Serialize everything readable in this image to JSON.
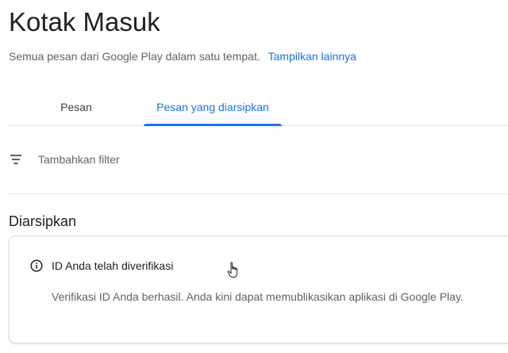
{
  "header": {
    "title": "Kotak Masuk",
    "subtitle": "Semua pesan dari Google Play dalam satu tempat.",
    "more_link": "Tampilkan lainnya"
  },
  "tabs": [
    {
      "label": "Pesan",
      "active": false
    },
    {
      "label": "Pesan yang diarsipkan",
      "active": true
    }
  ],
  "filter": {
    "icon": "filter-icon",
    "label": "Tambahkan filter"
  },
  "archived": {
    "heading": "Diarsipkan",
    "cards": [
      {
        "icon": "info-icon",
        "title": "ID Anda telah diverifikasi",
        "body": "Verifikasi ID Anda berhasil. Anda kini dapat memublikasikan aplikasi di Google Play."
      }
    ]
  },
  "colors": {
    "accent": "#1a73e8",
    "text_primary": "#202124",
    "text_secondary": "#5f6368",
    "divider": "#e3e3e3"
  }
}
